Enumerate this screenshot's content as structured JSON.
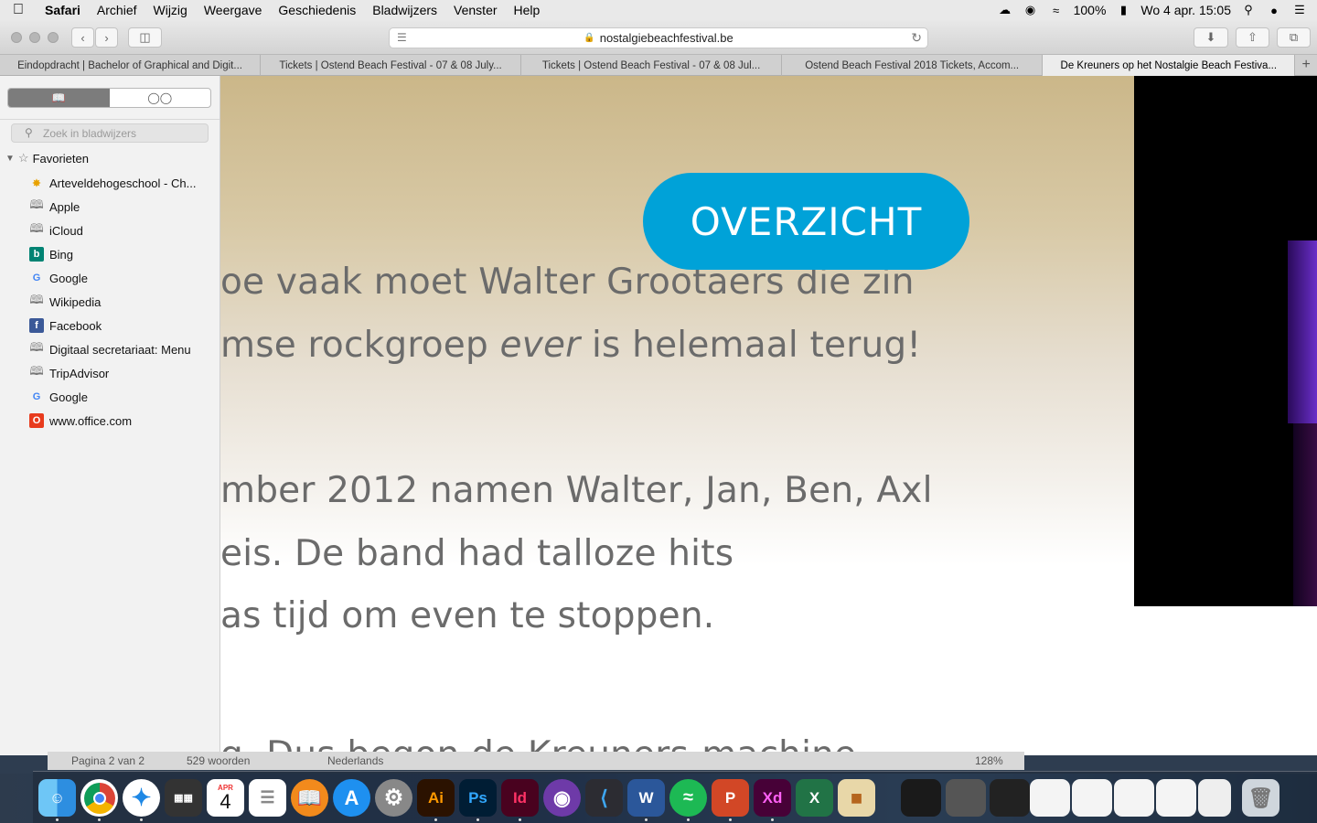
{
  "menubar": {
    "app": "Safari",
    "items": [
      "Archief",
      "Wijzig",
      "Weergave",
      "Geschiedenis",
      "Bladwijzers",
      "Venster",
      "Help"
    ],
    "battery": "100%",
    "datetime": "Wo 4 apr.  15:05"
  },
  "toolbar": {
    "url": "nostalgiebeachfestival.be"
  },
  "tabs": [
    {
      "title": "Eindopdracht | Bachelor of Graphical and Digit..."
    },
    {
      "title": "Tickets | Ostend Beach Festival - 07 & 08 July..."
    },
    {
      "title": "Tickets | Ostend Beach Festival - 07 & 08 Jul..."
    },
    {
      "title": "Ostend Beach Festival 2018 Tickets, Accom..."
    },
    {
      "title": "De Kreuners op het Nostalgie Beach Festiva..."
    }
  ],
  "sidebar": {
    "search_placeholder": "Zoek in bladwijzers",
    "favorites_label": "Favorieten",
    "items": [
      {
        "label": "Arteveldehogeschool - Ch...",
        "icon": "artevelde-icon"
      },
      {
        "label": "Apple",
        "icon": "book-icon"
      },
      {
        "label": "iCloud",
        "icon": "book-icon"
      },
      {
        "label": "Bing",
        "icon": "bing-icon"
      },
      {
        "label": "Google",
        "icon": "google-icon"
      },
      {
        "label": "Wikipedia",
        "icon": "book-icon"
      },
      {
        "label": "Facebook",
        "icon": "facebook-icon"
      },
      {
        "label": "Digitaal secretariaat: Menu",
        "icon": "book-icon"
      },
      {
        "label": "TripAdvisor",
        "icon": "book-icon"
      },
      {
        "label": "Google",
        "icon": "google-icon"
      },
      {
        "label": "www.office.com",
        "icon": "office-icon"
      }
    ]
  },
  "content": {
    "button": "OVERZICHT",
    "line1": "oe vaak moet Walter Grootaers die zin",
    "line2a": "mse rockgroep ",
    "line2em": "ever",
    "line2b": " is helemaal terug!",
    "line3": "mber 2012 namen Walter, Jan, Ben, Axl",
    "line4": "eis. De band had talloze hits",
    "line5": "as tijd om even te stoppen.",
    "line6": "g, Dus begon de Kreuners-machine"
  },
  "word_status": {
    "page": "Pagina 2 van 2",
    "words": "529 woorden",
    "language": "Nederlands",
    "zoom": "128%"
  },
  "dock": {
    "apps": [
      "Finder",
      "Chrome",
      "Safari",
      "Photo Booth",
      "Kalender",
      "Herinneringen",
      "iBooks",
      "App Store",
      "Systeemvoorkeuren",
      "Illustrator",
      "Photoshop",
      "InDesign",
      "GitHub",
      "Visual Studio Code",
      "Word",
      "Spotify",
      "PowerPoint",
      "Adobe XD",
      "Excel",
      "ColorSync"
    ],
    "calendar_month": "APR",
    "calendar_day": "4",
    "label_ai": "Ai",
    "label_ps": "Ps",
    "label_id": "Id",
    "label_xd": "Xd"
  },
  "colors": {
    "overzicht_button": "#00a2d8",
    "body_text": "#6b6b6b"
  }
}
